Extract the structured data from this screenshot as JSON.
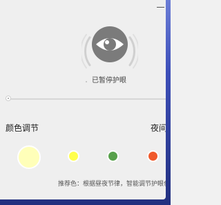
{
  "eye_protection": {
    "status_text": "已暂停护眼",
    "icon": "eye-icon"
  },
  "color_section": {
    "label": "颜色调节",
    "night_label": "夜间",
    "swatches": [
      {
        "name": "soft-yellow",
        "color": "#ffffb9",
        "selected": true
      },
      {
        "name": "yellow",
        "color": "#ffff4c"
      },
      {
        "name": "green",
        "color": "#58a14c"
      },
      {
        "name": "red",
        "color": "#f05a2c"
      }
    ]
  },
  "hint": {
    "text": "推荐色：根据昼夜节律，智能调节护眼色"
  },
  "colors": {
    "panel_bg": "#efefef",
    "wallpaper": "#3d4fb9"
  }
}
